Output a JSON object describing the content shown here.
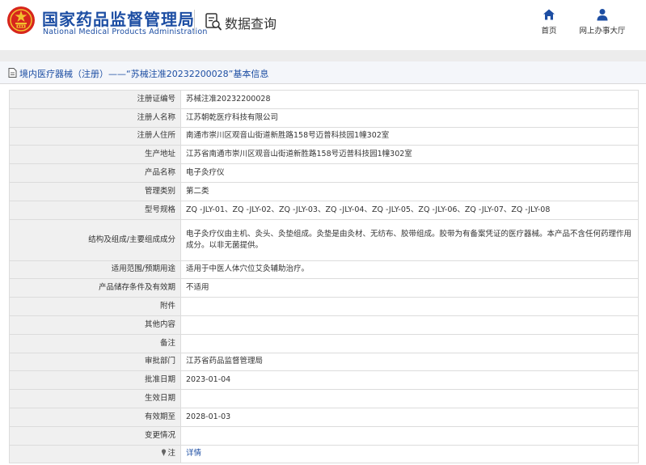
{
  "header": {
    "brand_cn": "国家药品监督管理局",
    "brand_en": "National Medical Products Administration",
    "query_title": "数据查询",
    "nav": {
      "home_label": "首页",
      "hall_label": "网上办事大厅"
    }
  },
  "breadcrumb": {
    "text": "境内医疗器械（注册）——“苏械注准20232200028”基本信息"
  },
  "rows": [
    {
      "label": "注册证编号",
      "value": "苏械注准20232200028"
    },
    {
      "label": "注册人名称",
      "value": "江苏朝乾医疗科技有限公司"
    },
    {
      "label": "注册人住所",
      "value": "南通市崇川区观音山街道新胜路158号迈普科技园1幢302室"
    },
    {
      "label": "生产地址",
      "value": "江苏省南通市崇川区观音山街道新胜路158号迈普科技园1幢302室"
    },
    {
      "label": "产品名称",
      "value": "电子灸疗仪"
    },
    {
      "label": "管理类别",
      "value": "第二类"
    },
    {
      "label": "型号规格",
      "value": "ZQ -JLY-01、ZQ -JLY-02、ZQ -JLY-03、ZQ -JLY-04、ZQ -JLY-05、ZQ -JLY-06、ZQ -JLY-07、ZQ -JLY-08"
    },
    {
      "label": "结构及组成/主要组成成分",
      "value": "电子灸疗仪由主机、灸头、灸垫组成。灸垫是由灸材、无纺布、胶带组成。胶带为有备案凭证的医疗器械。本产品不含任何药理作用成分。以非无菌提供。"
    },
    {
      "label": "适用范围/预期用途",
      "value": "适用于中医人体穴位艾灸辅助治疗。"
    },
    {
      "label": "产品储存条件及有效期",
      "value": "不适用"
    },
    {
      "label": "附件",
      "value": ""
    },
    {
      "label": "其他内容",
      "value": ""
    },
    {
      "label": "备注",
      "value": ""
    },
    {
      "label": "审批部门",
      "value": "江苏省药品监督管理局"
    },
    {
      "label": "批准日期",
      "value": "2023-01-04"
    },
    {
      "label": "生效日期",
      "value": ""
    },
    {
      "label": "有效期至",
      "value": "2028-01-03"
    },
    {
      "label": "变更情况",
      "value": ""
    }
  ],
  "note_row": {
    "label": "注",
    "link_text": "详情"
  },
  "colors": {
    "brand_blue": "#1d4ea3",
    "emblem_red": "#d7261c",
    "emblem_gold": "#f2c12e",
    "label_bg": "#f0f0f0"
  }
}
